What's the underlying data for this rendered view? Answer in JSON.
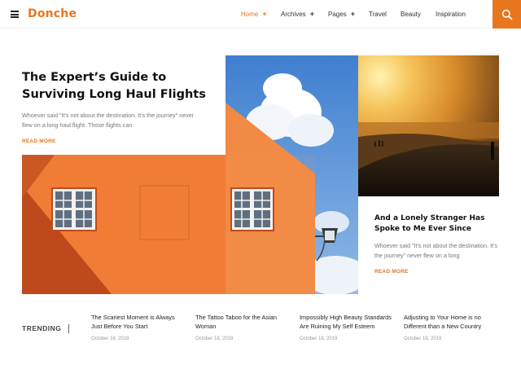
{
  "brand": {
    "logo": "Donche",
    "accent": "#e8761e"
  },
  "nav": [
    {
      "label": "Home",
      "plus": "+",
      "active": true
    },
    {
      "label": "Archives",
      "plus": "+"
    },
    {
      "label": "Pages",
      "plus": "+"
    },
    {
      "label": "Travel"
    },
    {
      "label": "Beauty"
    },
    {
      "label": "Inspiration"
    }
  ],
  "icons": {
    "menu": "hamburger-icon",
    "search": "search-icon"
  },
  "hero": {
    "title": "The Expert’s Guide to Surviving Long Haul Flights",
    "excerpt": "Whoever said \"It's not about the destination. It's the journey\" never flew on a long haul flight. Those flights can",
    "read_more": "READ MORE"
  },
  "side_feature": {
    "title": "And a Lonely Stranger Has Spoke to Me Ever Since",
    "excerpt": "Whoever said \"It's not about the destination. It's the journey\" never flew on a long",
    "read_more": "READ MORE"
  },
  "trending": {
    "label": "TRENDING",
    "items": [
      {
        "title": "The Scariest Moment is Always Just Before You Start",
        "date": "October 18, 2019"
      },
      {
        "title": "The Tattoo Taboo for the Asian Woman",
        "date": "October 18, 2019"
      },
      {
        "title": "Impossibly High Beauty Standards Are Ruining My Self Esteem",
        "date": "October 18, 2019"
      },
      {
        "title": "Adjusting to Your Home is no Different than a New Country",
        "date": "October 18, 2019"
      }
    ]
  }
}
